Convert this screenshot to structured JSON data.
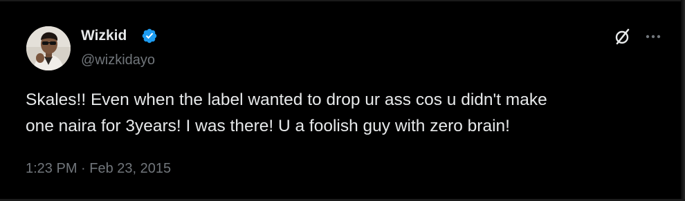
{
  "tweet": {
    "author": {
      "display_name": "Wizkid",
      "handle": "@wizkidayo",
      "verified": true
    },
    "text": "Skales!! Even when the label wanted to drop ur ass cos u didn't make\none naira for 3years! I was there! U a foolish guy with zero brain!",
    "timestamp": "1:23 PM · Feb 23, 2015"
  },
  "icons": {
    "verified_badge": "verified-badge-icon",
    "grok": "grok-icon",
    "more": "more-options-icon"
  },
  "colors": {
    "background": "#000000",
    "primary_text": "#e7e9ea",
    "secondary_text": "#71767b",
    "verified_blue": "#1d9bf0"
  }
}
